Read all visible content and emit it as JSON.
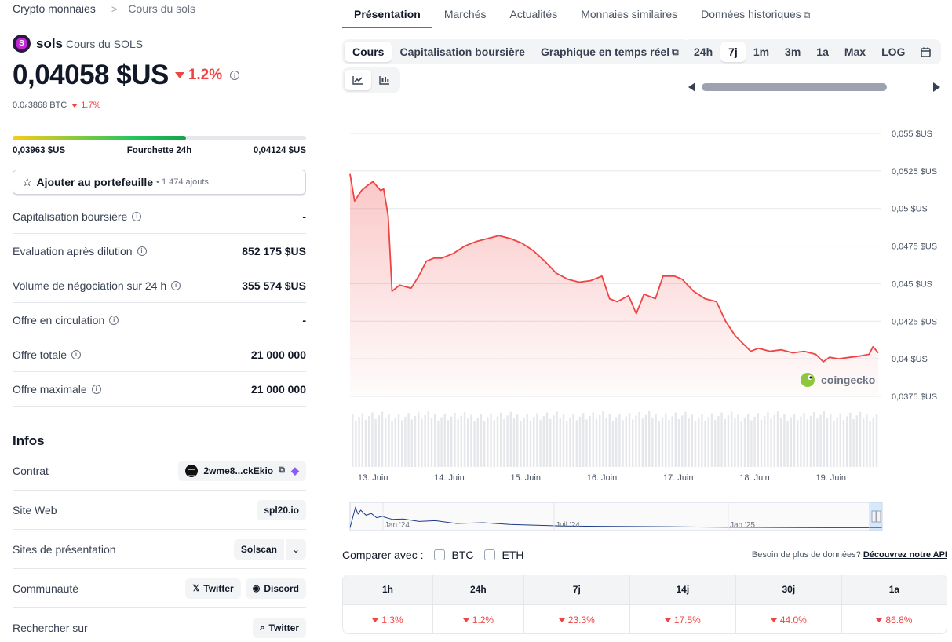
{
  "breadcrumb": {
    "root": "Crypto monnaies",
    "current": "Cours du sols"
  },
  "coin": {
    "name": "sols",
    "subtitle": "Cours du SOLS",
    "price": "0,04058 $US",
    "change_24h": "1.2%",
    "btc_price": "0.0₆3868 BTC",
    "btc_change": "1.7%"
  },
  "range": {
    "low": "0,03963 $US",
    "label": "Fourchette 24h",
    "high": "0,04124 $US",
    "position_fraction": 0.59
  },
  "portfolio": {
    "label": "Ajouter au portefeuille",
    "count": "• 1 474 ajouts"
  },
  "stats": [
    {
      "label": "Capitalisation boursière",
      "value": "-"
    },
    {
      "label": "Évaluation après dilution",
      "value": "852 175 $US"
    },
    {
      "label": "Volume de négociation sur 24 h",
      "value": "355 574 $US"
    },
    {
      "label": "Offre en circulation",
      "value": "-"
    },
    {
      "label": "Offre totale",
      "value": "21 000 000"
    },
    {
      "label": "Offre maximale",
      "value": "21 000 000"
    }
  ],
  "infos": {
    "title": "Infos",
    "contract_label": "Contrat",
    "contract_value": "2wme8...ckEkio",
    "website_label": "Site Web",
    "website_value": "spl20.io",
    "explorers_label": "Sites de présentation",
    "explorers_value": "Solscan",
    "community_label": "Communauté",
    "twitter": "Twitter",
    "discord": "Discord",
    "search_label": "Rechercher sur",
    "search_value": "Twitter"
  },
  "tabs": [
    "Présentation",
    "Marchés",
    "Actualités",
    "Monnaies similaires",
    "Données historiques"
  ],
  "chart_types": [
    "Cours",
    "Capitalisation boursière",
    "Graphique en temps réel"
  ],
  "ranges": [
    "24h",
    "7j",
    "1m",
    "3m",
    "1a",
    "Max",
    "LOG"
  ],
  "selected_range": "7j",
  "watermark": "coingecko",
  "chart_data": {
    "type": "area",
    "y_ticks": [
      "0,055 $US",
      "0,0525 $US",
      "0,05 $US",
      "0,0475 $US",
      "0,045 $US",
      "0,0425 $US",
      "0,04 $US",
      "0,0375 $US"
    ],
    "ylim": [
      0.0375,
      0.055
    ],
    "x_ticks": [
      "13. Juin",
      "14. Juin",
      "15. Juin",
      "16. Juin",
      "17. Juin",
      "18. Juin",
      "19. Juin"
    ],
    "xlim": [
      12.7,
      19.65
    ],
    "series": [
      {
        "color": "#ef4444",
        "x": [
          12.7,
          12.76,
          12.85,
          12.92,
          13.0,
          13.05,
          13.1,
          13.14,
          13.2,
          13.25,
          13.35,
          13.5,
          13.6,
          13.7,
          13.8,
          13.9,
          14.05,
          14.2,
          14.35,
          14.5,
          14.65,
          14.8,
          14.95,
          15.1,
          15.25,
          15.4,
          15.55,
          15.7,
          15.85,
          16.0,
          16.1,
          16.2,
          16.35,
          16.45,
          16.55,
          16.7,
          16.8,
          16.95,
          17.05,
          17.2,
          17.35,
          17.5,
          17.62,
          17.75,
          17.85,
          17.95,
          18.05,
          18.2,
          18.35,
          18.5,
          18.65,
          18.8,
          18.9,
          18.98,
          19.1,
          19.25,
          19.4,
          19.5,
          19.55,
          19.62
        ],
        "y": [
          0.0523,
          0.0505,
          0.0512,
          0.0515,
          0.0518,
          0.0515,
          0.0512,
          0.0513,
          0.0495,
          0.0445,
          0.0449,
          0.0447,
          0.0455,
          0.0465,
          0.0467,
          0.0467,
          0.047,
          0.0475,
          0.0478,
          0.048,
          0.0482,
          0.048,
          0.0477,
          0.0472,
          0.0465,
          0.0457,
          0.0453,
          0.0451,
          0.0452,
          0.0455,
          0.044,
          0.0438,
          0.0442,
          0.043,
          0.0443,
          0.044,
          0.0455,
          0.0455,
          0.0453,
          0.0445,
          0.044,
          0.0438,
          0.0425,
          0.0415,
          0.041,
          0.0405,
          0.0407,
          0.0405,
          0.0406,
          0.0404,
          0.0405,
          0.0403,
          0.0398,
          0.0401,
          0.04,
          0.0401,
          0.0402,
          0.0403,
          0.0408,
          0.0404
        ]
      }
    ],
    "minimap_ticks": [
      "Jan '24",
      "Juil '24",
      "Jan '25"
    ]
  },
  "compare": {
    "label": "Comparer avec :",
    "options": [
      "BTC",
      "ETH"
    ],
    "api_text": "Besoin de plus de données?",
    "api_link": "Découvrez notre API"
  },
  "performance": {
    "headers": [
      "1h",
      "24h",
      "7j",
      "14j",
      "30j",
      "1a"
    ],
    "values": [
      "1.3%",
      "1.2%",
      "23.3%",
      "17.5%",
      "44.0%",
      "86.8%"
    ]
  }
}
